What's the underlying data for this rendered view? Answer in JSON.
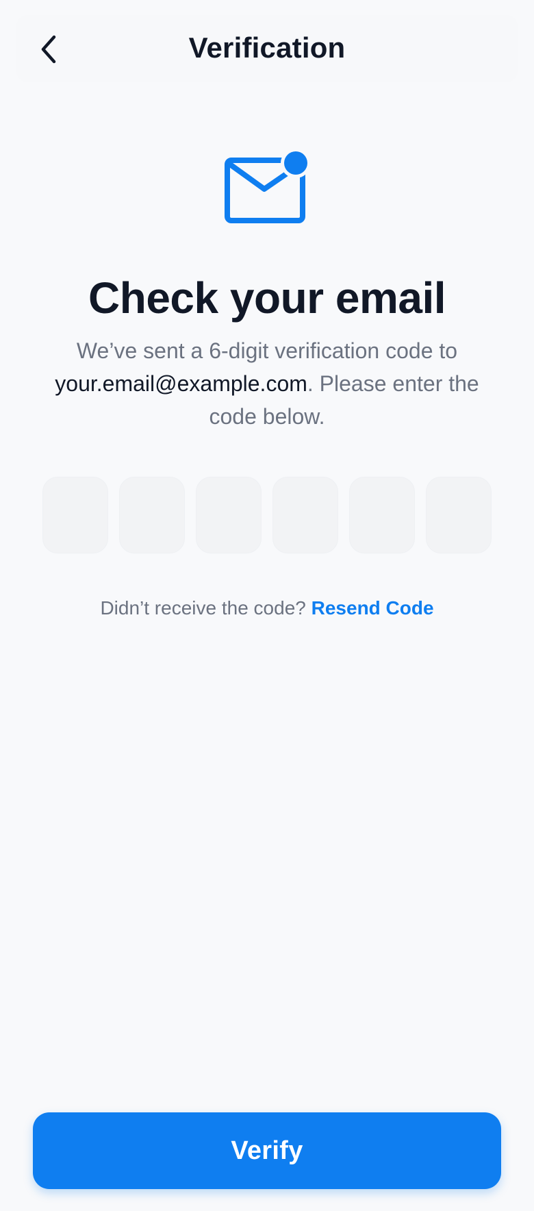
{
  "header": {
    "title": "Verification",
    "back_icon": "chevron-left-icon"
  },
  "hero": {
    "icon": "mail-notification-icon",
    "accent_color": "#0F7EF0",
    "heading": "Check your email",
    "description_before": "We’ve sent a 6-digit verification code to",
    "email": "your.email@example.com",
    "description_after": ". Please enter the code below."
  },
  "otp": {
    "digits": [
      "",
      "",
      "",
      "",
      "",
      ""
    ]
  },
  "resend": {
    "prompt": "Didn’t receive the code?",
    "link_label": "Resend Code"
  },
  "actions": {
    "verify_label": "Verify",
    "primary_color": "#0F7EF0"
  }
}
